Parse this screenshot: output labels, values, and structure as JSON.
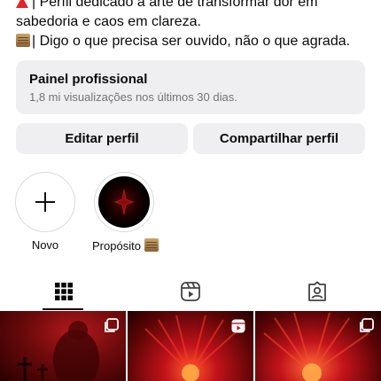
{
  "bio": {
    "line1": "| Perfil dedicado à arte de transformar dor em",
    "line2": "sabedoria e caos em clareza.",
    "line3": "| Digo o que precisa ser ouvido, não o que agrada."
  },
  "dashboard": {
    "title": "Painel profissional",
    "subtitle": "1,8 mi visualizações nos últimos 30 dias."
  },
  "buttons": {
    "edit_profile": "Editar perfil",
    "share_profile": "Compartilhar perfil"
  },
  "highlights": [
    {
      "label": "Novo",
      "icon": "plus-icon"
    },
    {
      "label": "Propósito",
      "icon": "scroll-emoji"
    }
  ],
  "tabs": [
    "grid-icon",
    "reels-icon",
    "tagged-icon"
  ],
  "active_tab": "grid",
  "posts": [
    {
      "type": "carousel",
      "icon": "carousel-icon"
    },
    {
      "type": "reel",
      "icon": "reels-icon"
    },
    {
      "type": "carousel",
      "icon": "carousel-icon"
    }
  ],
  "colors": {
    "accent_red": "#e0262b",
    "button_bg": "#efeff2",
    "muted_text": "#737373"
  }
}
